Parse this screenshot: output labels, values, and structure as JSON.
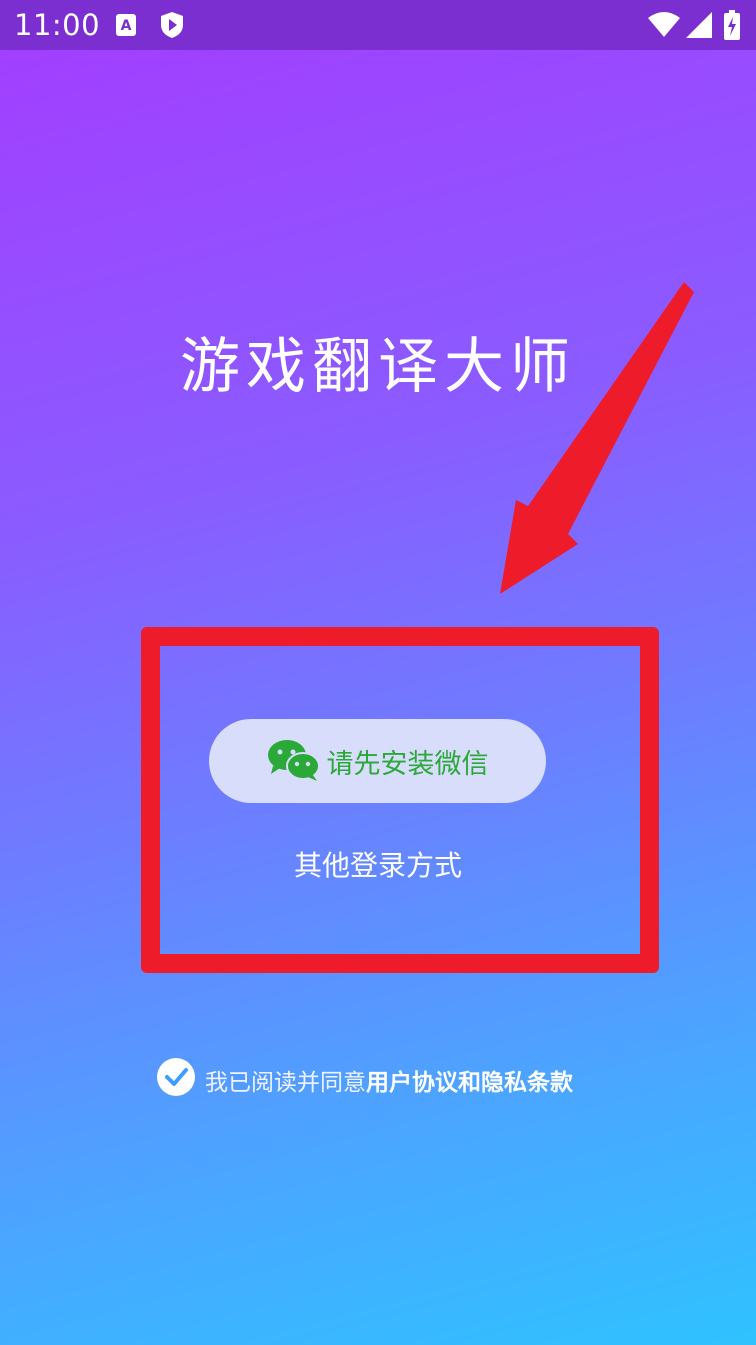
{
  "status_bar": {
    "time": "11:00",
    "icons": [
      "font-a-icon",
      "play-shield-icon",
      "wifi-icon",
      "signal-icon",
      "battery-icon"
    ],
    "background": "#7b2fd0"
  },
  "app": {
    "title": "游戏翻译大师"
  },
  "login": {
    "wechat_button_label": "请先安装微信",
    "wechat_color": "#2aa838",
    "other_login_label": "其他登录方式"
  },
  "agreement": {
    "checked": true,
    "prefix": "我已阅读并同意",
    "user_agreement": "用户协议",
    "conjunction": "和",
    "privacy_policy": "隐私条款"
  },
  "annotation": {
    "color": "#ee1c2b",
    "icons": [
      "red-arrow-icon",
      "red-highlight-box"
    ]
  }
}
